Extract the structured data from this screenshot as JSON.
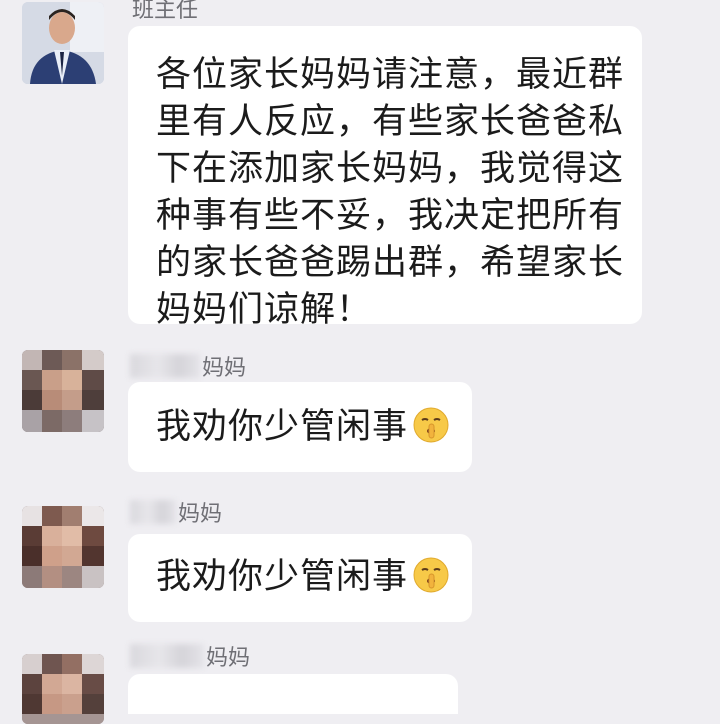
{
  "messages": [
    {
      "sender": "班主任",
      "text_lines": [
        "各位家长妈妈请注意，最近群",
        "里有人反应，有些家长爸爸私",
        "下在添加家长妈妈，我觉得这",
        "种事有些不妥，我决定把所有",
        "的家长爸爸踢出群，希望家长",
        "妈妈们谅解！"
      ],
      "avatar": "teacher-avatar"
    },
    {
      "sender_visible": "妈妈",
      "text": "我劝你少管闲事",
      "emoji": "shushing-face-emoji",
      "avatar": "blurred-avatar"
    },
    {
      "sender_visible": "妈妈",
      "text": "我劝你少管闲事",
      "emoji": "shushing-face-emoji",
      "avatar": "blurred-avatar"
    },
    {
      "sender_visible": "妈妈",
      "avatar": "blurred-avatar"
    }
  ],
  "colors": {
    "background": "#efeef2",
    "bubble": "#ffffff",
    "sender_text": "#6f6f75",
    "message_text": "#1b1b1b",
    "emoji_face": "#f7c948"
  }
}
